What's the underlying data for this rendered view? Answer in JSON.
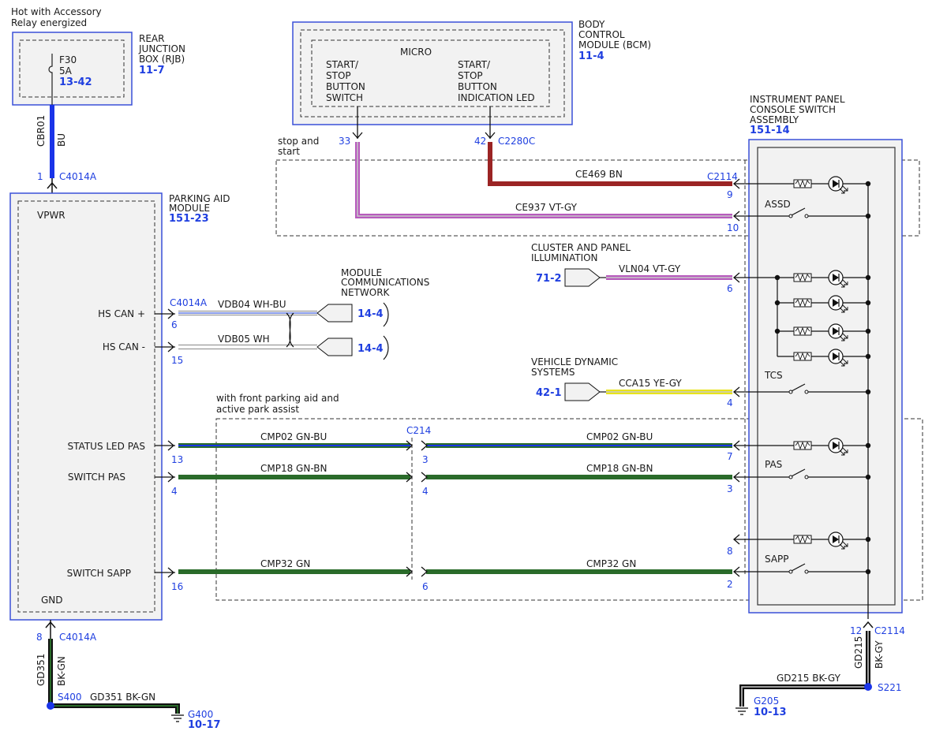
{
  "colors": {
    "module_border": "#3a50d8",
    "module_fill": "#f2f2f2",
    "ref_text": "#1f3fe0",
    "BU": "#1a34e8",
    "BN": "#9b2424",
    "VT": "#b75bbd",
    "GY": "#c9c9c9",
    "YE": "#e8e31a",
    "GN": "#2a6b2a",
    "BK": "#111111",
    "WH": "#ffffff",
    "WH_BU_stripe": "#3c5ad8"
  },
  "header": {
    "hot_line1": "Hot with Accessory",
    "hot_line2": "Relay energized"
  },
  "rjb": {
    "label_lines": [
      "REAR",
      "JUNCTION",
      "BOX (RJB)"
    ],
    "ref": "11-7",
    "fuse_name": "F30",
    "fuse_rating": "5A",
    "fuse_ref": "13-42",
    "wire_circuit": "CBR01",
    "wire_color": "BU",
    "pin": "1",
    "connector": "C4014A"
  },
  "bcm": {
    "label_lines": [
      "BODY",
      "CONTROL",
      "MODULE (BCM)"
    ],
    "ref": "11-4",
    "micro": "MICRO",
    "left_fn": [
      "START/",
      "STOP",
      "BUTTON",
      "SWITCH"
    ],
    "right_fn": [
      "START/",
      "STOP",
      "BUTTON",
      "INDICATION LED"
    ],
    "pin_left": "33",
    "pin_right": "42",
    "connector": "C2280C"
  },
  "stop_start_option": [
    "stop and",
    "start"
  ],
  "pam": {
    "label_lines": [
      "PARKING AID",
      "MODULE"
    ],
    "ref": "151-23",
    "vpwr": "VPWR",
    "gnd": "GND",
    "hs_can_plus": "HS CAN +",
    "hs_can_minus": "HS CAN -",
    "status_led_pas": "STATUS LED PAS",
    "switch_pas": "SWITCH PAS",
    "switch_sapp": "SWITCH SAPP",
    "connector": "C4014A",
    "pin_can_plus": "6",
    "pin_can_minus": "15",
    "pin_status": "13",
    "pin_switch_pas": "4",
    "pin_sapp": "16",
    "pin_gnd": "8",
    "gnd_connector": "C4014A"
  },
  "mcn": {
    "label_lines": [
      "MODULE",
      "COMMUNICATIONS",
      "NETWORK"
    ],
    "ref_plus": "14-4",
    "ref_minus": "14-4",
    "wire_plus": "VDB04  WH-BU",
    "wire_minus": "VDB05  WH"
  },
  "ipcsa": {
    "label_lines": [
      "INSTRUMENT PANEL",
      "CONSOLE SWITCH",
      "ASSEMBLY"
    ],
    "ref": "151-14",
    "connector": "C2114",
    "assd": "ASSD",
    "tcs": "TCS",
    "pas": "PAS",
    "sapp": "SAPP",
    "pins": {
      "p9": "9",
      "p10": "10",
      "p6": "6",
      "p4": "4",
      "p7": "7",
      "p3": "3",
      "p8": "8",
      "p2": "2"
    },
    "gnd_pin": "12",
    "gnd_connector": "C2114"
  },
  "wires": {
    "ce469": "CE469   BN",
    "ce937": "CE937   VT-GY",
    "vln04": "VLN04   VT-GY",
    "cca15": "CCA15   YE-GY",
    "cmp02_left": "CMP02   GN-BU",
    "cmp02_right": "CMP02   GN-BU",
    "cmp18_left": "CMP18   GN-BN",
    "cmp18_right": "CMP18   GN-BN",
    "cmp32_left": "CMP32   GN",
    "cmp32_right": "CMP32   GN"
  },
  "cluster": {
    "label_lines": [
      "CLUSTER AND PANEL",
      "ILLUMINATION"
    ],
    "ref": "71-2"
  },
  "vds": {
    "label_lines": [
      "VEHICLE DYNAMIC",
      "SYSTEMS"
    ],
    "ref": "42-1"
  },
  "front_parking": [
    "with front parking aid and",
    "active park assist"
  ],
  "c214": {
    "name": "C214",
    "pin_status": "3",
    "pin_pas": "4",
    "pin_sapp": "6"
  },
  "ground_left": {
    "wire_circuit": "GD351",
    "wire_color": "BK-GN",
    "splice": "S400",
    "wire_label": "GD351   BK-GN",
    "ground": "G400",
    "ref": "10-17"
  },
  "ground_right": {
    "wire_circuit": "GD215",
    "wire_color": "BK-GY",
    "splice": "S221",
    "wire_label": "GD215   BK-GY",
    "ground": "G205",
    "ref": "10-13"
  }
}
